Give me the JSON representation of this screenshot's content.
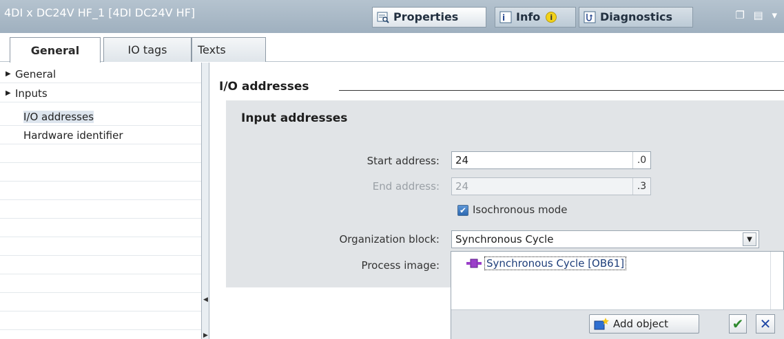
{
  "window": {
    "title": "4DI x DC24V HF_1 [4DI DC24V HF]",
    "tabs": [
      {
        "label": "Properties",
        "icon": "properties-icon"
      },
      {
        "label": "Info",
        "icon": "info-icon"
      },
      {
        "label": "Diagnostics",
        "icon": "diagnostics-icon"
      }
    ],
    "controls": "❐ ▤ ▾"
  },
  "subtabs": [
    "General",
    "IO tags",
    "Texts"
  ],
  "nav": {
    "items": [
      {
        "label": "General",
        "expandable": true
      },
      {
        "label": "Inputs",
        "expandable": true
      },
      {
        "label": "I/O addresses",
        "expandable": false,
        "selected": true
      },
      {
        "label": "Hardware identifier",
        "expandable": false
      }
    ]
  },
  "section": {
    "title": "I/O addresses",
    "group_title": "Input addresses",
    "start_address": {
      "label": "Start address:",
      "value": "24",
      "bit": ".0"
    },
    "end_address": {
      "label": "End address:",
      "value": "24",
      "bit": ".3"
    },
    "isochronous": {
      "label": "Isochronous mode",
      "checked": true
    },
    "organization_block": {
      "label": "Organization block:",
      "value": "Synchronous Cycle"
    },
    "process_image": {
      "label": "Process image:"
    }
  },
  "ob_list": {
    "items": [
      "Synchronous Cycle [OB61]"
    ],
    "add_object": "Add object"
  },
  "colors": {
    "titlebar": "#a9b9c7",
    "group_bg": "#e1e4e7",
    "accent": "#2c68b1"
  }
}
